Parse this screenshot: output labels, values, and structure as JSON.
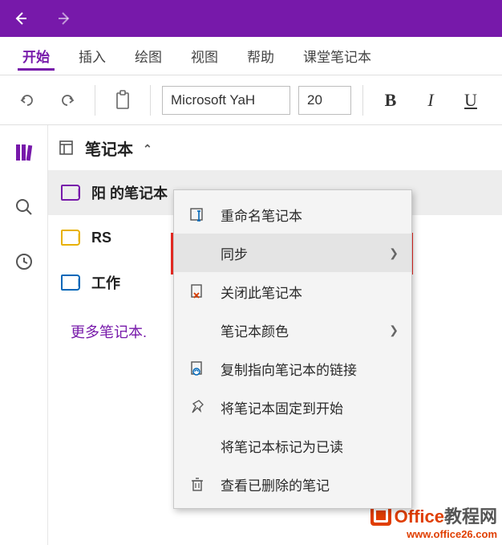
{
  "tabs": {
    "start": "开始",
    "insert": "插入",
    "draw": "绘图",
    "view": "视图",
    "help": "帮助",
    "classnb": "课堂笔记本"
  },
  "toolbar": {
    "font_name": "Microsoft YaH",
    "font_size": "20",
    "bold": "B",
    "italic": "I",
    "underline": "U"
  },
  "panel": {
    "header": "笔记本",
    "items": [
      {
        "label": "阳 的笔记本"
      },
      {
        "label": "RS"
      },
      {
        "label": "工作"
      }
    ],
    "more": "更多笔记本."
  },
  "context_menu": {
    "rename": "重命名笔记本",
    "sync": "同步",
    "close": "关闭此笔记本",
    "color": "笔记本颜色",
    "copy_link": "复制指向笔记本的链接",
    "pin_start": "将笔记本固定到开始",
    "mark_read": "将笔记本标记为已读",
    "deleted": "查看已删除的笔记"
  },
  "watermark": {
    "brand1": "Office",
    "brand2": "教程网",
    "url": "www.office26.com"
  }
}
